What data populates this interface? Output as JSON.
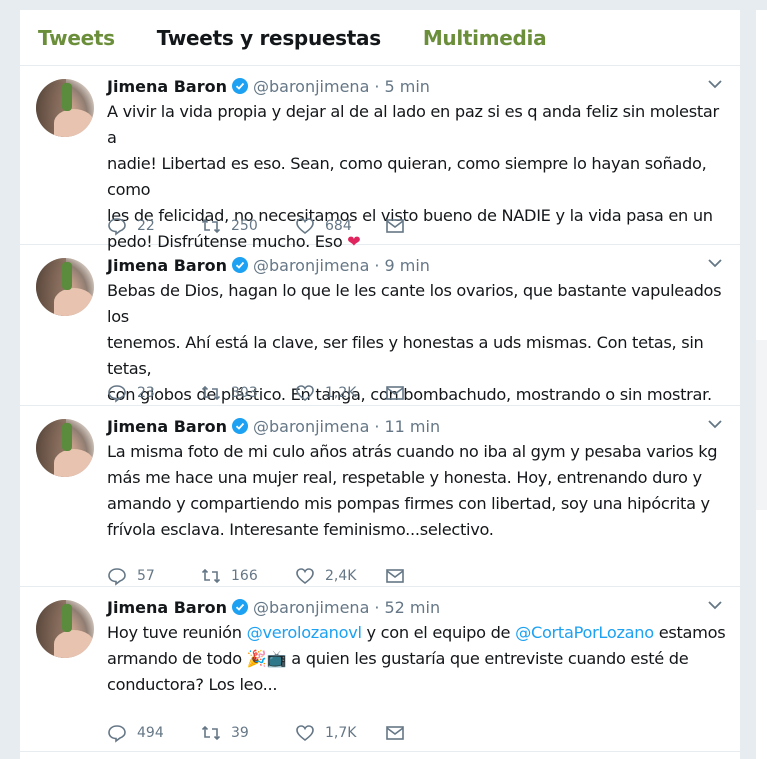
{
  "tabs": [
    "Tweets",
    "Tweets y respuestas",
    "Multimedia"
  ],
  "tweets": [
    {
      "name": "Jimena Baron",
      "handle": "@baronjimena",
      "time": "5 min",
      "lines": [
        "A vivir la vida propia y dejar al de al lado en paz si es q anda feliz sin molestar a",
        "nadie! Libertad es eso. Sean, como quieran, como siempre lo hayan soñado, como",
        "les de felicidad, no necesitamos el visto bueno de NADIE y la vida pasa en un",
        "pedo! Disfrútense mucho. Eso"
      ],
      "heart_emoji": "❤",
      "replies": "22",
      "retweets": "250",
      "likes": "684"
    },
    {
      "name": "Jimena Baron",
      "handle": "@baronjimena",
      "time": "9 min",
      "lines": [
        "Bebas de Dios, hagan lo que le les cante los ovarios, que bastante vapuleados los",
        "tenemos. Ahí está la clave, ser files y honestas a uds mismas. Con tetas, sin tetas,",
        "con  globos de plástico. En tanga, con bombachudo, mostrando o sin mostrar."
      ],
      "replies": "23",
      "retweets": "303",
      "likes": "1,2K"
    },
    {
      "name": "Jimena Baron",
      "handle": "@baronjimena",
      "time": "11 min",
      "lines": [
        "La misma foto de mi culo años atrás cuando no iba al gym y pesaba varios kg",
        "más me hace una mujer real, respetable y honesta. Hoy, entrenando duro y",
        "amando y compartiendo mis pompas firmes con libertad, soy una hipócrita y",
        "frívola esclava. Interesante feminismo...selectivo."
      ],
      "replies": "57",
      "retweets": "166",
      "likes": "2,4K"
    },
    {
      "name": "Jimena Baron",
      "handle": "@baronjimena",
      "time": "52 min",
      "line1_pre": "Hoy tuve reunión ",
      "mention1": "@verolozanovl",
      "line1_mid": " y con el equipo de ",
      "mention2": "@CortaPorLozano",
      "line1_post": " estamos",
      "line2_pre": "armando de todo ",
      "emojis": "🎉📺",
      "line2_post": " a quien les gustaría que entreviste cuando esté de",
      "line3": "conductora? Los leo...",
      "replies": "494",
      "retweets": "39",
      "likes": "1,7K"
    }
  ],
  "colors": {
    "tab_active_green": "#6b8e3a",
    "link_blue": "#1da1f2",
    "verified_blue": "#1da1f2",
    "heart_red": "#e0245e",
    "muted_gray": "#657786"
  }
}
